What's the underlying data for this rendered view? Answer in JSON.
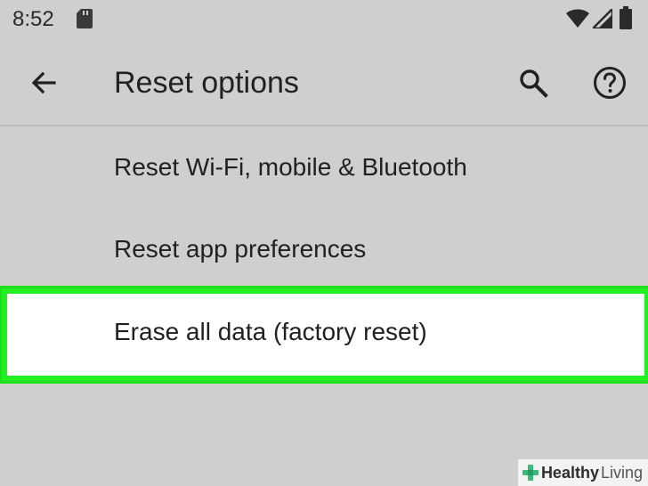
{
  "status_bar": {
    "time": "8:52",
    "icons": [
      "sd-card-icon",
      "wifi-icon",
      "cell-signal-icon",
      "battery-icon"
    ]
  },
  "app_bar": {
    "title": "Reset options",
    "back_icon": "arrow-back-icon",
    "search_icon": "search-icon",
    "help_icon": "help-circle-icon"
  },
  "options": [
    {
      "label": "Reset Wi-Fi, mobile & Bluetooth"
    },
    {
      "label": "Reset app preferences"
    },
    {
      "label": "Erase all data (factory reset)",
      "highlighted": true
    }
  ],
  "watermark": {
    "part1": "Healthy",
    "part2": "Living"
  },
  "colors": {
    "background": "#cfcfcf",
    "highlight_border": "#22f022",
    "highlight_fill": "#ffffff",
    "text": "#202124"
  }
}
